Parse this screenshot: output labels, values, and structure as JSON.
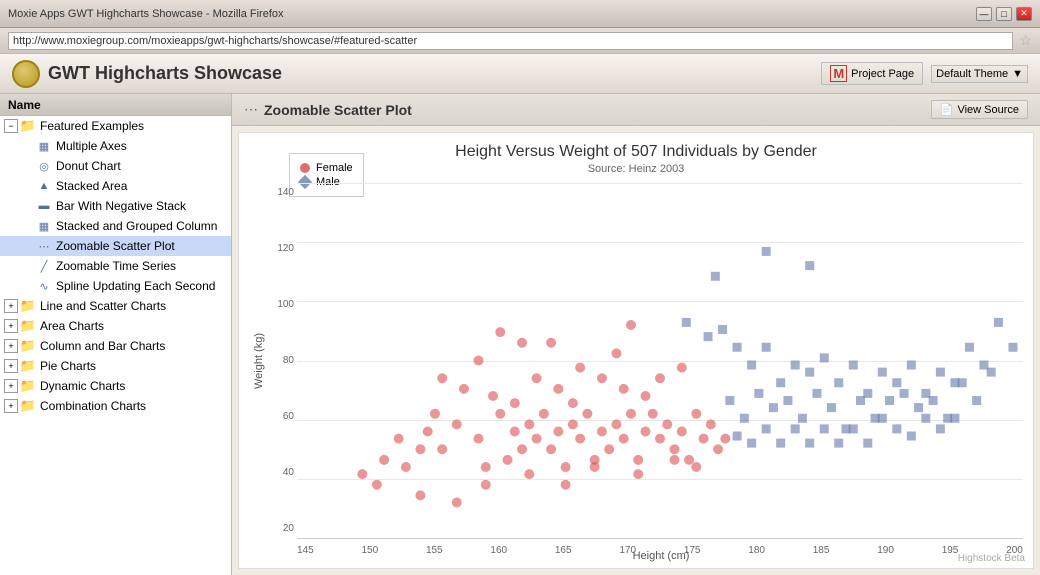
{
  "browser": {
    "title": "Moxie Apps GWT Highcharts Showcase - Mozilla Firefox",
    "address": "http://www.moxiegroup.com/moxieapps/gwt-highcharts/showcase/#featured-scatter",
    "controls": {
      "minimize": "—",
      "maximize": "□",
      "close": "✕"
    }
  },
  "app": {
    "title": "GWT Highcharts Showcase",
    "project_page_label": "Project Page",
    "theme_select_label": "Default Theme",
    "view_source_label": "View Source"
  },
  "sidebar": {
    "header": "Name",
    "items": [
      {
        "id": "featured-examples",
        "label": "Featured Examples",
        "level": 0,
        "expanded": true,
        "type": "folder"
      },
      {
        "id": "multiple-axes",
        "label": "Multiple Axes",
        "level": 1,
        "type": "chart-bar"
      },
      {
        "id": "donut-chart",
        "label": "Donut Chart",
        "level": 1,
        "type": "chart-pie"
      },
      {
        "id": "stacked-area",
        "label": "Stacked Area",
        "level": 1,
        "type": "chart-area"
      },
      {
        "id": "bar-negative-stack",
        "label": "Bar With Negative Stack",
        "level": 1,
        "type": "chart-bar"
      },
      {
        "id": "stacked-grouped-column",
        "label": "Stacked and Grouped Column",
        "level": 1,
        "type": "chart-bar"
      },
      {
        "id": "zoomable-scatter",
        "label": "Zoomable Scatter Plot",
        "level": 1,
        "type": "chart-scatter",
        "selected": true
      },
      {
        "id": "zoomable-time",
        "label": "Zoomable Time Series",
        "level": 1,
        "type": "chart-line"
      },
      {
        "id": "spline-updating",
        "label": "Spline Updating Each Second",
        "level": 1,
        "type": "chart-spline"
      },
      {
        "id": "line-scatter",
        "label": "Line and Scatter Charts",
        "level": 0,
        "type": "folder-closed"
      },
      {
        "id": "area-charts",
        "label": "Area Charts",
        "level": 0,
        "type": "folder-closed"
      },
      {
        "id": "column-bar-charts",
        "label": "Column and Bar Charts",
        "level": 0,
        "type": "folder-closed"
      },
      {
        "id": "pie-charts",
        "label": "Pie Charts",
        "level": 0,
        "type": "folder-closed"
      },
      {
        "id": "dynamic-charts",
        "label": "Dynamic Charts",
        "level": 0,
        "type": "folder-closed"
      },
      {
        "id": "combination-charts",
        "label": "Combination Charts",
        "level": 0,
        "type": "folder-closed"
      }
    ]
  },
  "chart": {
    "header_title": "Zoomable Scatter Plot",
    "main_title": "Height Versus Weight of 507 Individuals by Gender",
    "subtitle": "Source: Heinz 2003",
    "y_axis_label": "Weight (kg)",
    "x_axis_label": "Height (cm)",
    "y_ticks": [
      "140",
      "120",
      "100",
      "80",
      "60",
      "40",
      "20"
    ],
    "x_ticks": [
      "145",
      "150",
      "155",
      "160",
      "165",
      "170",
      "175",
      "180",
      "185",
      "190",
      "195",
      "200"
    ],
    "legend": [
      {
        "label": "Female",
        "color": "#e07070",
        "shape": "circle"
      },
      {
        "label": "Male",
        "color": "#8899bb",
        "shape": "diamond"
      }
    ],
    "watermark": "Highstock Beta"
  }
}
